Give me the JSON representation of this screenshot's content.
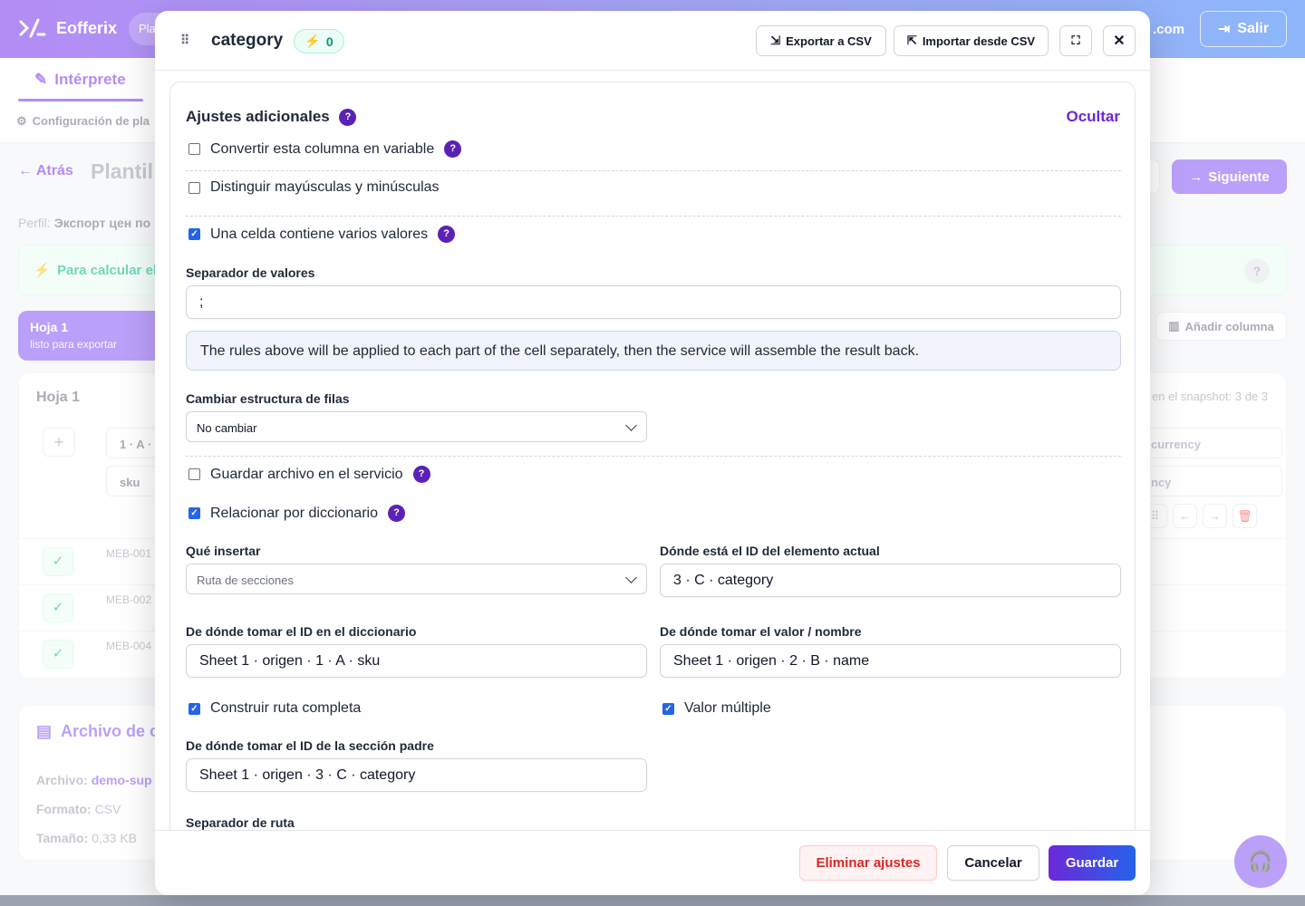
{
  "app": {
    "name": "Eofferix",
    "plan_pill": "Pla",
    "domain_fragment": ".com",
    "logout_label": "Salir",
    "accent": "#7c3aed"
  },
  "subnav": {
    "tab_label": "Intérprete",
    "config_label": "Configuración de pla"
  },
  "page": {
    "back_label": "Atrás",
    "title": "Plantil",
    "next_label": "Siguiente",
    "profile_label": "Perfil:",
    "profile_value": "Экспорт цен по",
    "calc_text": "Para calcular el",
    "add_column_label": "Añadir columna",
    "sheet_tab": {
      "name": "Hoja 1",
      "status": "listo para exportar"
    }
  },
  "sheet_card": {
    "title": "Hoja 1",
    "snapshot": "en el snapshot: 3 de 3",
    "col1_header": "1 · A ·",
    "col1_sub": "sku",
    "col_last_header": "currency",
    "col_last_sub": "ncy",
    "rows": [
      "MEB-001",
      "MEB-002",
      "MEB-004"
    ]
  },
  "file_card": {
    "title": "Archivo de o",
    "file_label": "Archivo:",
    "file_value": "demo-sup",
    "format_label": "Formato:",
    "format_value": "CSV",
    "size_label": "Tamaño:",
    "size_value": "0,33 KB"
  },
  "modal": {
    "title": "category",
    "badge_count": "0",
    "export_label": "Exportar a CSV",
    "import_label": "Importar desde CSV",
    "section_title": "Ajustes adicionales",
    "hide_label": "Ocultar",
    "opt_variable": "Convertir esta columna en variable",
    "opt_case": "Distinguir mayúsculas y minúsculas",
    "opt_multi": "Una celda contiene varios valores",
    "sep_values_label": "Separador de valores",
    "sep_values_value": ";",
    "info_text": "The rules above will be applied to each part of the cell separately, then the service will assemble the result back.",
    "row_structure_label": "Cambiar estructura de filas",
    "row_structure_value": "No cambiar",
    "opt_save_file": "Guardar archivo en el servicio",
    "opt_dictionary": "Relacionar por diccionario",
    "what_insert_label": "Qué insertar",
    "what_insert_value": "Ruta de secciones",
    "current_id_label": "Dónde está el ID del elemento actual",
    "current_id_value": "3 · C · category",
    "dict_id_label": "De dónde tomar el ID en el diccionario",
    "dict_id_value": "Sheet 1 · origen · 1 · A · sku",
    "dict_name_label": "De dónde tomar el valor / nombre",
    "dict_name_value": "Sheet 1 · origen · 2 · B · name",
    "opt_full_path": "Construir ruta completa",
    "opt_multiple": "Valor múltiple",
    "parent_id_label": "De dónde tomar el ID de la sección padre",
    "parent_id_value": "Sheet 1 · origen · 3 · C · category",
    "path_sep_label": "Separador de ruta",
    "delete_label": "Eliminar ajustes",
    "cancel_label": "Cancelar",
    "save_label": "Guardar"
  },
  "checkbox_state": {
    "variable": false,
    "case": false,
    "multi": true,
    "save_file": false,
    "dictionary": true,
    "full_path": true,
    "multiple": true
  }
}
